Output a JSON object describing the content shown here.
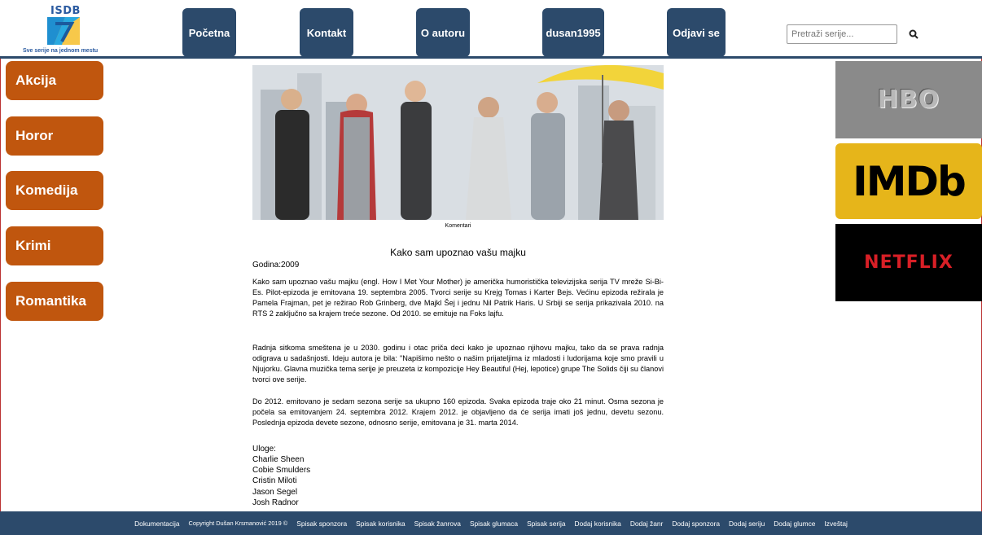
{
  "header": {
    "logo_text": "ISDB",
    "logo_tagline": "Sve serije na jednom mestu",
    "nav": [
      "Početna",
      "Kontakt",
      "O autoru",
      "dusan1995",
      "Odjavi se"
    ],
    "search_placeholder": "Pretraži serije..."
  },
  "sidebar": {
    "categories": [
      "Akcija",
      "Horor",
      "Komedija",
      "Krimi",
      "Romantika"
    ]
  },
  "main": {
    "image_caption": "Komentari",
    "title": "Kako sam upoznao vašu majku",
    "year": "Godina:2009",
    "paragraphs": [
      "Kako sam upoznao vašu majku (engl. How I Met Your Mother) je američka humoristička televizijska serija TV mreže Si-Bi-Es. Pilot-epizoda je emitovana 19. septembra 2005. Tvorci serije su Krejg Tomas i Karter Bejs. Većinu epizoda režirala je Pamela Frajman, pet je režirao Rob Grinberg, dve Majkl Šej i jednu Nil Patrik Haris. U Srbiji se serija prikazivala 2010. na RTS 2 zaključno sa krajem treće sezone. Od 2010. se emituje na Foks lajfu.",
      "Radnja sitkoma smeštena je u 2030. godinu i otac priča deci kako je upoznao njihovu majku, tako da se prava radnja odigrava u sadašnjosti. Ideju autora je bila: \"Napišimo nešto o našim prijateljima iz mladosti i ludorijama koje smo pravili u Njujorku. Glavna muzička tema serije je preuzeta iz kompozicije Hey Beautiful (Hej, lepotice) grupe The Solids čiji su članovi tvorci ove serije.",
      "Do 2012. emitovano je sedam sezona serije sa ukupno 160 epizoda. Svaka epizoda traje oko 21 minut. Osma sezona je počela sa emitovanjem 24. septembra 2012. Krajem 2012. je objavljeno da će serija imati još jednu, devetu sezonu. Poslednja epizoda devete sezone, odnosno serije, emitovana je 31. marta 2014."
    ],
    "cast_label": "Uloge:",
    "cast": [
      "Charlie Sheen",
      "Cobie Smulders",
      "Cristin Miloti",
      "Jason Segel",
      "Josh Radnor"
    ]
  },
  "sponsors": {
    "hbo": "HBO",
    "imdb": "IMDb",
    "netflix": "NETFLIX"
  },
  "footer": {
    "doc": "Dokumentacija",
    "copyright": "Copyright Dušan Krsmanović 2019 ©",
    "links": [
      "Spisak sponzora",
      "Spisak korisnika",
      "Spisak žanrova",
      "Spisak glumaca",
      "Spisak serija",
      "Dodaj korisnika",
      "Dodaj žanr",
      "Dodaj sponzora",
      "Dodaj seriju",
      "Dodaj glumce",
      "Izveštaj"
    ]
  },
  "colors": {
    "nav": "#2c4a6b",
    "category": "#c0560e",
    "footer": "#2c4a6b"
  }
}
